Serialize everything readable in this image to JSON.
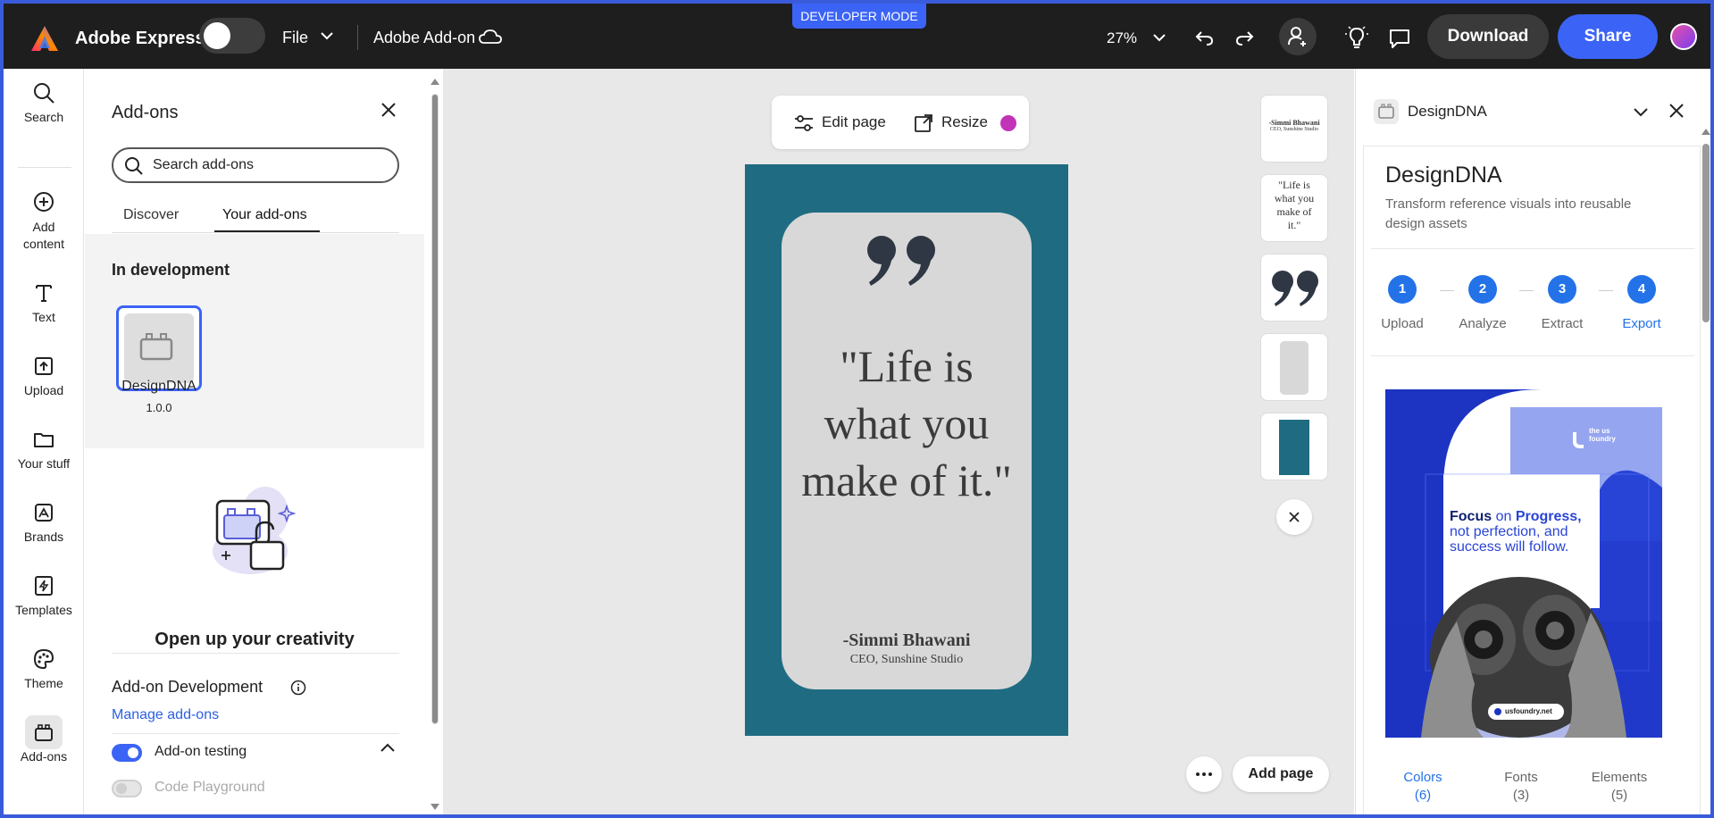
{
  "topbar": {
    "brand": "Adobe Express",
    "file_label": "File",
    "doc_name": "Adobe Add-on",
    "dev_mode": "DEVELOPER MODE",
    "zoom": "27%",
    "download": "Download",
    "share": "Share"
  },
  "rail": {
    "items": [
      {
        "label": "Search",
        "icon": "search-icon"
      },
      {
        "label": "Add content",
        "icon": "plus-circle-icon"
      },
      {
        "label": "Text",
        "icon": "text-icon"
      },
      {
        "label": "Upload",
        "icon": "upload-icon"
      },
      {
        "label": "Your stuff",
        "icon": "folder-icon"
      },
      {
        "label": "Brands",
        "icon": "brand-icon"
      },
      {
        "label": "Templates",
        "icon": "templates-icon"
      },
      {
        "label": "Theme",
        "icon": "palette-icon"
      },
      {
        "label": "Add-ons",
        "icon": "addons-icon"
      }
    ],
    "active": "Add-ons"
  },
  "addons": {
    "title": "Add-ons",
    "search_placeholder": "Search add-ons",
    "tabs": [
      "Discover",
      "Your add-ons"
    ],
    "active_tab": "Your add-ons",
    "in_development_label": "In development",
    "addon": {
      "name": "DesignDNA",
      "version": "1.0.0"
    },
    "creativity": "Open up your creativity",
    "dev_title": "Add-on Development",
    "manage_link": "Manage add-ons",
    "testing_label": "Add-on testing",
    "testing_on": true,
    "playground_label": "Code Playground",
    "playground_on": false
  },
  "canvas": {
    "edit_page": "Edit page",
    "resize": "Resize",
    "add_page": "Add page",
    "poster": {
      "quote": "\"Life is what you make of it.\"",
      "author": "-Simmi Bhawani",
      "role": "CEO, Sunshine Studio",
      "background": "#1f6c82",
      "card_color": "#d8d8d8"
    },
    "thumbnails": [
      {
        "name": "-Simmi Bhawani",
        "sub": "CEO, Sunshine Studio"
      },
      {
        "name": "\"Life is what you make of it.\""
      },
      {
        "name": "quote-marks"
      },
      {
        "name": "grey-card"
      },
      {
        "name": "teal-rectangle"
      }
    ]
  },
  "rpanel": {
    "header": "DesignDNA",
    "title": "DesignDNA",
    "subtitle": "Transform reference visuals into reusable design assets",
    "steps": [
      {
        "num": "1",
        "label": "Upload"
      },
      {
        "num": "2",
        "label": "Analyze"
      },
      {
        "num": "3",
        "label": "Extract"
      },
      {
        "num": "4",
        "label": "Export"
      }
    ],
    "active_step": "Export",
    "reference": {
      "brand": "the us foundry",
      "headline_bold": "Focus",
      "headline_mid": " on ",
      "headline_bold2": "Progress,",
      "headline_rest": "not perfection, and success will follow.",
      "footer": "usfoundry.net"
    },
    "tabs": [
      {
        "label": "Colors",
        "count": "(6)"
      },
      {
        "label": "Fonts",
        "count": "(3)"
      },
      {
        "label": "Elements",
        "count": "(5)"
      }
    ],
    "active_tab": "Colors",
    "accent": "#2372e8"
  }
}
